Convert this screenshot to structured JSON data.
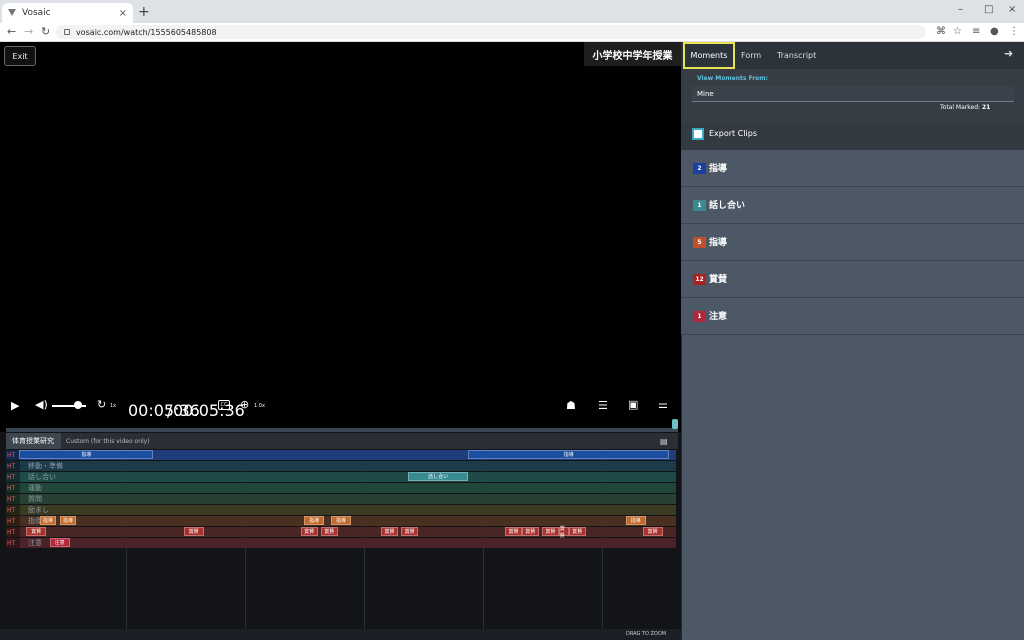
{
  "browser": {
    "tab_title": "Vosaic",
    "tab_close": "×",
    "new_tab": "+",
    "url": "vosaic.com/watch/1555605485808",
    "win_min": "–",
    "win_max": "□",
    "win_close": "×"
  },
  "video": {
    "exit_label": "Exit",
    "title": "小学校中学年授業",
    "current_time": "00:05:36",
    "separator": "/",
    "duration": "00:05:36",
    "replay_speed": "1x",
    "zoom": "1.0x",
    "progress_fraction": 1.0,
    "volume_fraction": 0.7
  },
  "timeline": {
    "tab_a": "体育授業研究",
    "tab_b": "Custom (for this video only)",
    "drag_to_zoom": "DRAG TO ZOOM",
    "ht": "HT",
    "rows": [
      {
        "name": "指導",
        "color": "#1f3d7a",
        "marks": [
          {
            "label": "指導",
            "color": "#1b4ea0",
            "s": 0.02,
            "w": 0.2
          },
          {
            "label": "指導",
            "color": "#1b4ea0",
            "s": 0.69,
            "w": 0.3
          }
        ]
      },
      {
        "name": "移動・準備",
        "color": "#1d3a49",
        "marks": []
      },
      {
        "name": "話し合い",
        "color": "#1f4a48",
        "marks": [
          {
            "label": "話し合い",
            "color": "#3a8a92",
            "s": 0.6,
            "w": 0.09
          }
        ]
      },
      {
        "name": "運動",
        "color": "#20463a",
        "marks": []
      },
      {
        "name": "質問",
        "color": "#284034",
        "marks": []
      },
      {
        "name": "励まし",
        "color": "#3b3a23",
        "marks": []
      },
      {
        "name": "指導",
        "color": "#4a3020",
        "marks": [
          {
            "label": "指導",
            "color": "#c06a2e",
            "s": 0.05,
            "w": 0.025
          },
          {
            "label": "指導",
            "color": "#c06a2e",
            "s": 0.08,
            "w": 0.025
          },
          {
            "label": "指導",
            "color": "#c06a2e",
            "s": 0.445,
            "w": 0.03
          },
          {
            "label": "指導",
            "color": "#c06a2e",
            "s": 0.485,
            "w": 0.03
          },
          {
            "label": "指導",
            "color": "#c06a2e",
            "s": 0.925,
            "w": 0.03
          }
        ]
      },
      {
        "name": "賞賛",
        "color": "#4a2525",
        "marks": [
          {
            "label": "賞賛",
            "color": "#a8332e",
            "s": 0.03,
            "w": 0.03
          },
          {
            "label": "賞賛",
            "color": "#a8332e",
            "s": 0.265,
            "w": 0.03
          },
          {
            "label": "賞賛",
            "color": "#a8332e",
            "s": 0.44,
            "w": 0.025
          },
          {
            "label": "賞賛",
            "color": "#a8332e",
            "s": 0.47,
            "w": 0.025
          },
          {
            "label": "賞賛",
            "color": "#a8332e",
            "s": 0.56,
            "w": 0.025
          },
          {
            "label": "賞賛",
            "color": "#a8332e",
            "s": 0.59,
            "w": 0.025
          },
          {
            "label": "賞賛",
            "color": "#a8332e",
            "s": 0.745,
            "w": 0.025
          },
          {
            "label": "賞賛",
            "color": "#a8332e",
            "s": 0.77,
            "w": 0.025
          },
          {
            "label": "賞賛",
            "color": "#a8332e",
            "s": 0.8,
            "w": 0.025
          },
          {
            "label": "賞賛",
            "color": "#a8332e",
            "s": 0.825,
            "w": 0.015
          },
          {
            "label": "賞賛",
            "color": "#a8332e",
            "s": 0.84,
            "w": 0.025
          },
          {
            "label": "賞賛",
            "color": "#a8332e",
            "s": 0.95,
            "w": 0.03
          }
        ]
      },
      {
        "name": "注意",
        "color": "#4a2228",
        "marks": [
          {
            "label": "注意",
            "color": "#b0283a",
            "s": 0.065,
            "w": 0.03
          }
        ]
      }
    ]
  },
  "panel": {
    "tabs": [
      "Moments",
      "Form",
      "Transcript"
    ],
    "view_from_label": "View Moments From:",
    "view_from_value": "Mine",
    "total_label": "Total Marked:",
    "total_value": "21",
    "export_label": "Export Clips",
    "categories": [
      {
        "count": "2",
        "label": "指導",
        "color": "#1a3fa0"
      },
      {
        "count": "1",
        "label": "話し合い",
        "color": "#3a8a92"
      },
      {
        "count": "5",
        "label": "指導",
        "color": "#c0502a"
      },
      {
        "count": "12",
        "label": "賞賛",
        "color": "#a8221e"
      },
      {
        "count": "1",
        "label": "注意",
        "color": "#b0283a"
      }
    ]
  },
  "icons": [
    "play-icon",
    "volume-icon",
    "replay-icon",
    "closed-caption-icon",
    "zoom-icon",
    "person-list-icon",
    "list-icon",
    "add-comment-icon",
    "sliders-icon",
    "back-icon",
    "forward-icon",
    "reload-icon",
    "lock-icon",
    "translate-icon",
    "star-icon",
    "playlist-icon",
    "profile-icon",
    "more-icon",
    "exit-arrow-icon",
    "layers-icon"
  ]
}
